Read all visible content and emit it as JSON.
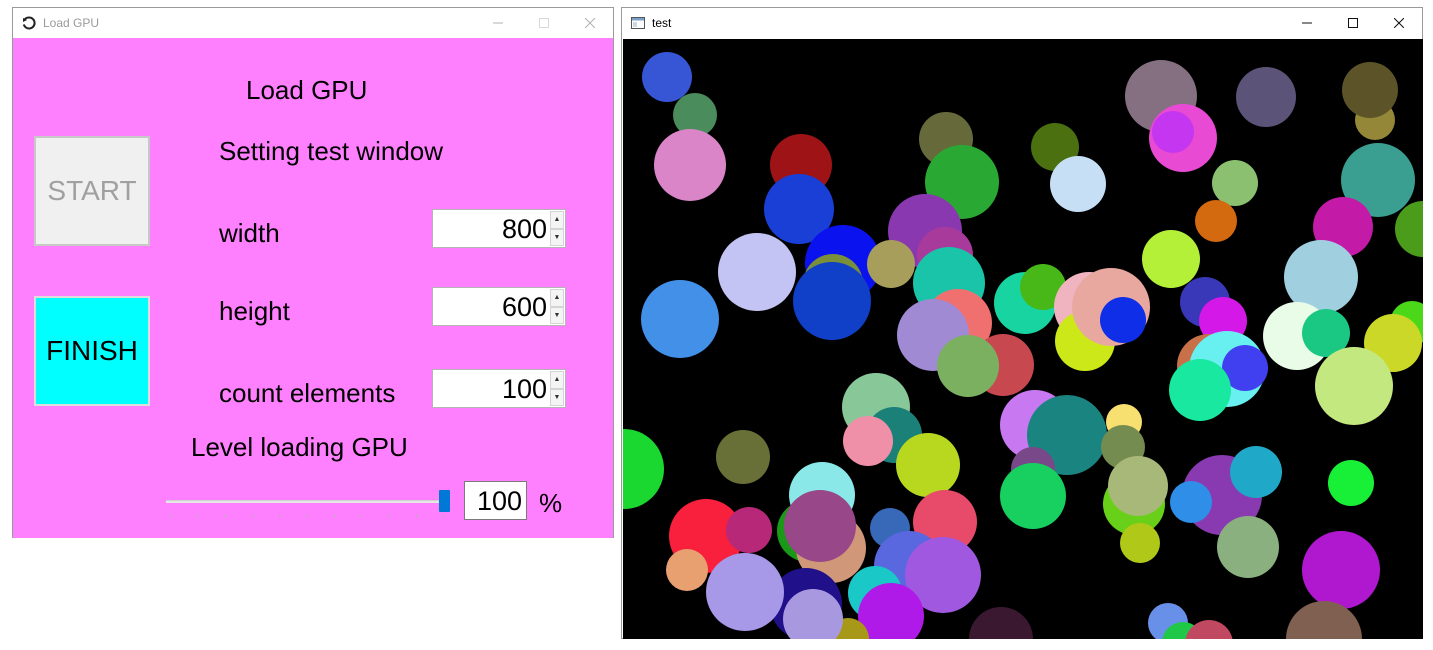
{
  "load_gpu_window": {
    "title": "Load GPU",
    "heading": "Load GPU",
    "start_label": "START",
    "finish_label": "FINISH",
    "settings_heading": "Setting test window",
    "width_label": "width",
    "width_value": "800",
    "height_label": "height",
    "height_value": "600",
    "count_label": "count elements",
    "count_value": "100",
    "level_label": "Level loading GPU",
    "level_value": "100",
    "level_unit": "%",
    "slider_fraction": 1.0,
    "background_color": "#ff80ff",
    "finish_color": "#00ffff"
  },
  "test_window": {
    "title": "test",
    "background_color": "#000000",
    "circles": [
      {
        "color": "#3656d6"
      },
      {
        "color": "#4a8c5c"
      },
      {
        "color": "#d985c8"
      },
      {
        "color": "#9e1416"
      },
      {
        "color": "#1a3fd6"
      },
      {
        "color": "#c4c4f4"
      },
      {
        "color": "#4390e8"
      },
      {
        "color": "#0a12f0"
      },
      {
        "color": "#7a8f3a"
      },
      {
        "color": "#1140c8"
      },
      {
        "color": "#666a3a"
      },
      {
        "color": "#2aa834"
      },
      {
        "color": "#8a38b0"
      },
      {
        "color": "#a83a9c"
      },
      {
        "color": "#a89e5c"
      },
      {
        "color": "#1ac4a8"
      },
      {
        "color": "#f07070"
      },
      {
        "color": "#a08ad4"
      },
      {
        "color": "#4a7010"
      },
      {
        "color": "#c6dff4"
      },
      {
        "color": "#847080"
      },
      {
        "color": "#e84ad4"
      },
      {
        "color": "#c436f0"
      },
      {
        "color": "#5c5478"
      },
      {
        "color": "#948838"
      },
      {
        "color": "#5c5428"
      },
      {
        "color": "#3a9e90"
      },
      {
        "color": "#8ac070"
      },
      {
        "color": "#d46a10"
      },
      {
        "color": "#c41aa8"
      },
      {
        "color": "#4a9c1a"
      },
      {
        "color": "#b4f038"
      },
      {
        "color": "#a0d0e0"
      },
      {
        "color": "#18d4a0"
      },
      {
        "color": "#48b818"
      },
      {
        "color": "#f0b4c0"
      },
      {
        "color": "#cce818"
      },
      {
        "color": "#e8a8a0"
      },
      {
        "color": "#0e2ee8"
      },
      {
        "color": "#3838b8"
      },
      {
        "color": "#d418e8"
      },
      {
        "color": "#e8fce8"
      },
      {
        "color": "#1ac884"
      },
      {
        "color": "#4ad818"
      },
      {
        "color": "#ccd828"
      },
      {
        "color": "#c84850"
      },
      {
        "color": "#c87048"
      },
      {
        "color": "#68f0f0"
      },
      {
        "color": "#4040f0"
      },
      {
        "color": "#18e8a0"
      },
      {
        "color": "#c4e880"
      },
      {
        "color": "#7ab060"
      },
      {
        "color": "#88c898"
      },
      {
        "color": "#1a8078"
      },
      {
        "color": "#f090a8"
      },
      {
        "color": "#b8d820"
      },
      {
        "color": "#c878f0"
      },
      {
        "color": "#1a8480"
      },
      {
        "color": "#f8e070"
      },
      {
        "color": "#748c50"
      },
      {
        "color": "#784888"
      },
      {
        "color": "#18d060"
      },
      {
        "color": "#68d018"
      },
      {
        "color": "#a8b878"
      },
      {
        "color": "#1ad830"
      },
      {
        "color": "#18f038"
      },
      {
        "color": "#8a3ab0"
      },
      {
        "color": "#20a8c8"
      },
      {
        "color": "#2e8ee8"
      },
      {
        "color": "#8ab080"
      },
      {
        "color": "#b018d0"
      },
      {
        "color": "#b0c818"
      },
      {
        "color": "#687038"
      },
      {
        "color": "#8ae8e8"
      },
      {
        "color": "#f8203c"
      },
      {
        "color": "#b82878"
      },
      {
        "color": "#e8a070"
      },
      {
        "color": "#1a9818"
      },
      {
        "color": "#d09878"
      },
      {
        "color": "#984888"
      },
      {
        "color": "#3868b8"
      },
      {
        "color": "#e84a6a"
      },
      {
        "color": "#5a68e0"
      },
      {
        "color": "#a058e0"
      },
      {
        "color": "#1ac8c8"
      },
      {
        "color": "#b01ae8"
      },
      {
        "color": "#20108a"
      },
      {
        "color": "#a898e8"
      },
      {
        "color": "#a89818"
      },
      {
        "color": "#3a1830"
      },
      {
        "color": "#6890e8"
      },
      {
        "color": "#20c848"
      },
      {
        "color": "#c04860"
      },
      {
        "color": "#806050"
      },
      {
        "color": "#a898e0"
      }
    ]
  }
}
